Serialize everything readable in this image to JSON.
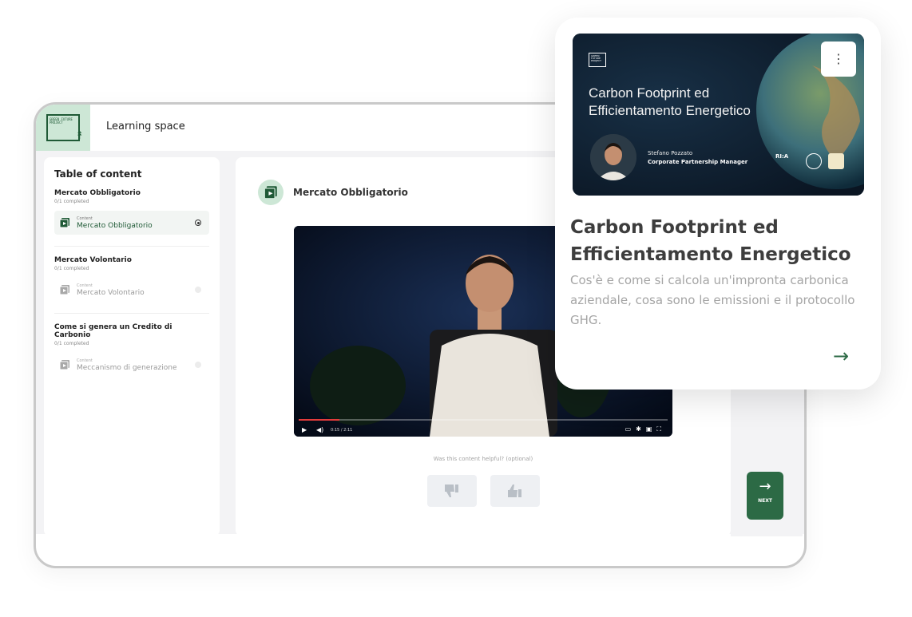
{
  "app": {
    "title": "Learning space",
    "logo_text": "GREEN FUTURE PROJECT"
  },
  "sidebar": {
    "title": "Table of content",
    "sections": [
      {
        "title": "Mercato Obbligatorio",
        "progress": "0/1 completed",
        "item_kind": "Content",
        "item_name": "Mercato Obbligatorio",
        "active": true
      },
      {
        "title": "Mercato Volontario",
        "progress": "0/1 completed",
        "item_kind": "Content",
        "item_name": "Mercato Volontario",
        "active": false
      },
      {
        "title": "Come si genera un Credito di Carbonio",
        "progress": "0/1 completed",
        "item_kind": "Content",
        "item_name": "Meccanismo di generazione",
        "active": false
      }
    ]
  },
  "content": {
    "header_title": "Mercato Obbligatorio",
    "video": {
      "time": "0:15 / 2:11",
      "progress_fraction": 0.11
    },
    "feedback_prompt": "Was this content helpful? (optional)",
    "next_label": "NEXT"
  },
  "card": {
    "thumbnail_title": "Carbon Footprint ed\nEfficientamento Energetico",
    "presenter_name": "Stefano Pozzato",
    "presenter_role": "Corporate Partnership Manager",
    "title": "Carbon Footprint ed Efficientamento Energetico",
    "description": "Cos'è e come si calcola un'impronta carbonica aziendale, cosa sono le emissioni e il protocollo GHG.",
    "badge_text": "RI:A"
  },
  "colors": {
    "brand_green": "#2c6a45",
    "mint": "#cde7d6"
  }
}
